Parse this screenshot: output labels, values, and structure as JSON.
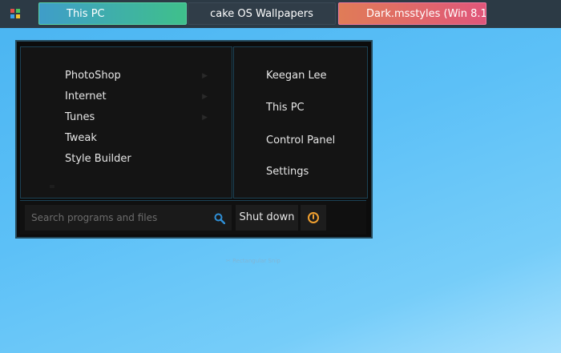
{
  "taskbar": {
    "start_icon": "windows-logo-icon",
    "tasks": [
      {
        "label": "This PC"
      },
      {
        "label": "cake OS Wallpapers"
      },
      {
        "label": "Dark.msstyles (Win 8.1..."
      }
    ]
  },
  "start_menu": {
    "programs": [
      {
        "label": "PhotoShop",
        "has_submenu": true
      },
      {
        "label": "Internet",
        "has_submenu": true
      },
      {
        "label": "Tunes",
        "has_submenu": true
      },
      {
        "label": "Tweak",
        "has_submenu": false
      },
      {
        "label": "Style Builder",
        "has_submenu": false
      }
    ],
    "places": [
      {
        "label": "Keegan Lee"
      },
      {
        "label": "This PC"
      },
      {
        "label": "Control Panel"
      },
      {
        "label": "Settings"
      }
    ],
    "search_placeholder": "Search programs and files",
    "shutdown_label": "Shut down"
  },
  "desktop": {
    "ghost_text": "Rectangular Snip"
  },
  "colors": {
    "start_green": "#4cc35a",
    "start_red": "#e0504a",
    "start_blue": "#3aa0e8",
    "start_yellow": "#f2c230",
    "search_icon": "#2f8fd6",
    "power_icon": "#f0a030"
  }
}
